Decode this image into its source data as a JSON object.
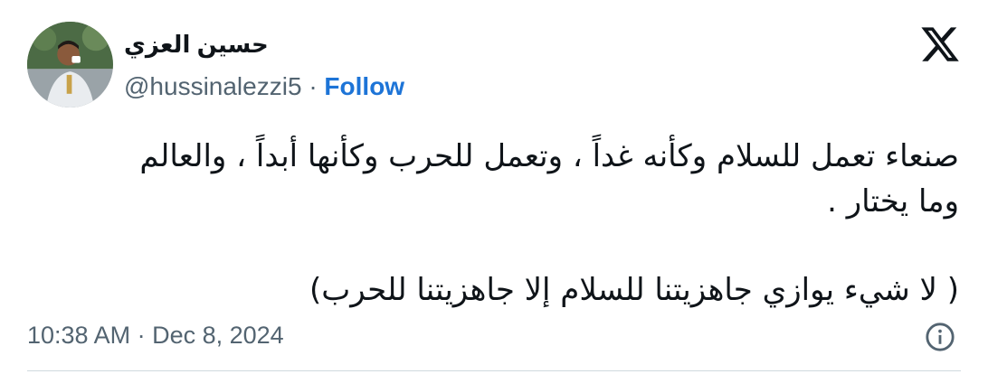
{
  "author": {
    "display_name": "حسين العزي",
    "handle": "@hussinalezzi5",
    "separator": "·",
    "follow_label": "Follow",
    "avatar_icon": "profile-photo"
  },
  "brand": {
    "logo_icon": "x-logo"
  },
  "tweet": {
    "line1": "صنعاء تعمل للسلام وكأنه غداً ، وتعمل للحرب وكأنها أبداً ، والعالم",
    "line2": "وما يختار .",
    "line3": "( لا شيء يوازي جاهزيتنا للسلام إلا جاهزيتنا للحرب)"
  },
  "meta": {
    "timestamp": "10:38 AM · Dec 8, 2024",
    "info_icon": "info-icon"
  },
  "colors": {
    "text": "#0f1419",
    "secondary": "#536471",
    "follow": "#1d74d7",
    "divider": "#cfd9de"
  }
}
